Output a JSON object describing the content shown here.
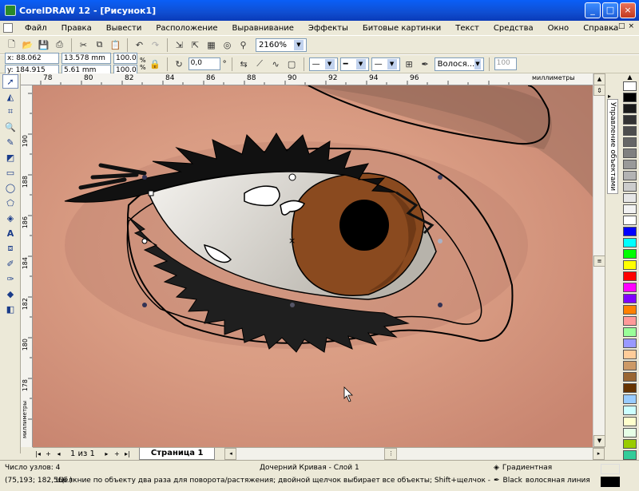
{
  "title": "CorelDRAW 12 - [Рисунок1]",
  "window_buttons": [
    "_",
    "□",
    "×"
  ],
  "menu": [
    "Файл",
    "Правка",
    "Вывести",
    "Расположение",
    "Выравнивание",
    "Эффекты",
    "Битовые картинки",
    "Текст",
    "Средства",
    "Окно",
    "Справка"
  ],
  "toolbar1": {
    "zoom": "2160%"
  },
  "propbar": {
    "x": "x: 88.062 mm",
    "y": "y: 184.915 mm",
    "w": "13.578 mm",
    "h": "5.61 mm",
    "scale_x": "100.0",
    "scale_y": "100.0",
    "pct": "%",
    "rotation": "0,0",
    "deg": "°",
    "outline_width": "Волося...",
    "smooth": "100"
  },
  "ruler_h": {
    "ticks": [
      "78",
      "80",
      "82",
      "84",
      "86",
      "88",
      "90",
      "92",
      "94",
      "96"
    ],
    "unit": "миллиметры"
  },
  "ruler_v": {
    "ticks": [
      "190",
      "188",
      "186",
      "184",
      "182",
      "180",
      "178"
    ],
    "unit": "миллиметры"
  },
  "docker_label": "Управление объектами",
  "palette": [
    "#ffffff",
    "#000000",
    "#1a1a1a",
    "#333333",
    "#4d4d4d",
    "#666666",
    "#808080",
    "#999999",
    "#b3b3b3",
    "#cccccc",
    "#e6e6e6",
    "#f2f2f2",
    "#ffffff",
    "#0000ff",
    "#00ffff",
    "#00ff00",
    "#ffff00",
    "#ff0000",
    "#ff00ff",
    "#8000ff",
    "#ff8000",
    "#ff9999",
    "#99ff99",
    "#9999ff",
    "#ffcc99",
    "#cc9966",
    "#996633",
    "#663300",
    "#99ccff",
    "#ccffff",
    "#ffffcc",
    "#e6ffe6",
    "#99cc00",
    "#33cc99",
    "#00ccff"
  ],
  "pagebar": {
    "count": "1 из 1",
    "page_tab": "Страница 1"
  },
  "status": {
    "nodes": "Число узлов: 4",
    "object": "Дочерний Кривая - Слой 1",
    "coords": "(75,193; 182,566 )",
    "hint": "Щёлкние по объекту два раза для поворота/растяжения; двойной щелчок выбирает все объекты; Shift+щелчок - выбор не...",
    "fill": "Градиентная",
    "outline_color": "Black",
    "outline": "волосяная линия"
  }
}
